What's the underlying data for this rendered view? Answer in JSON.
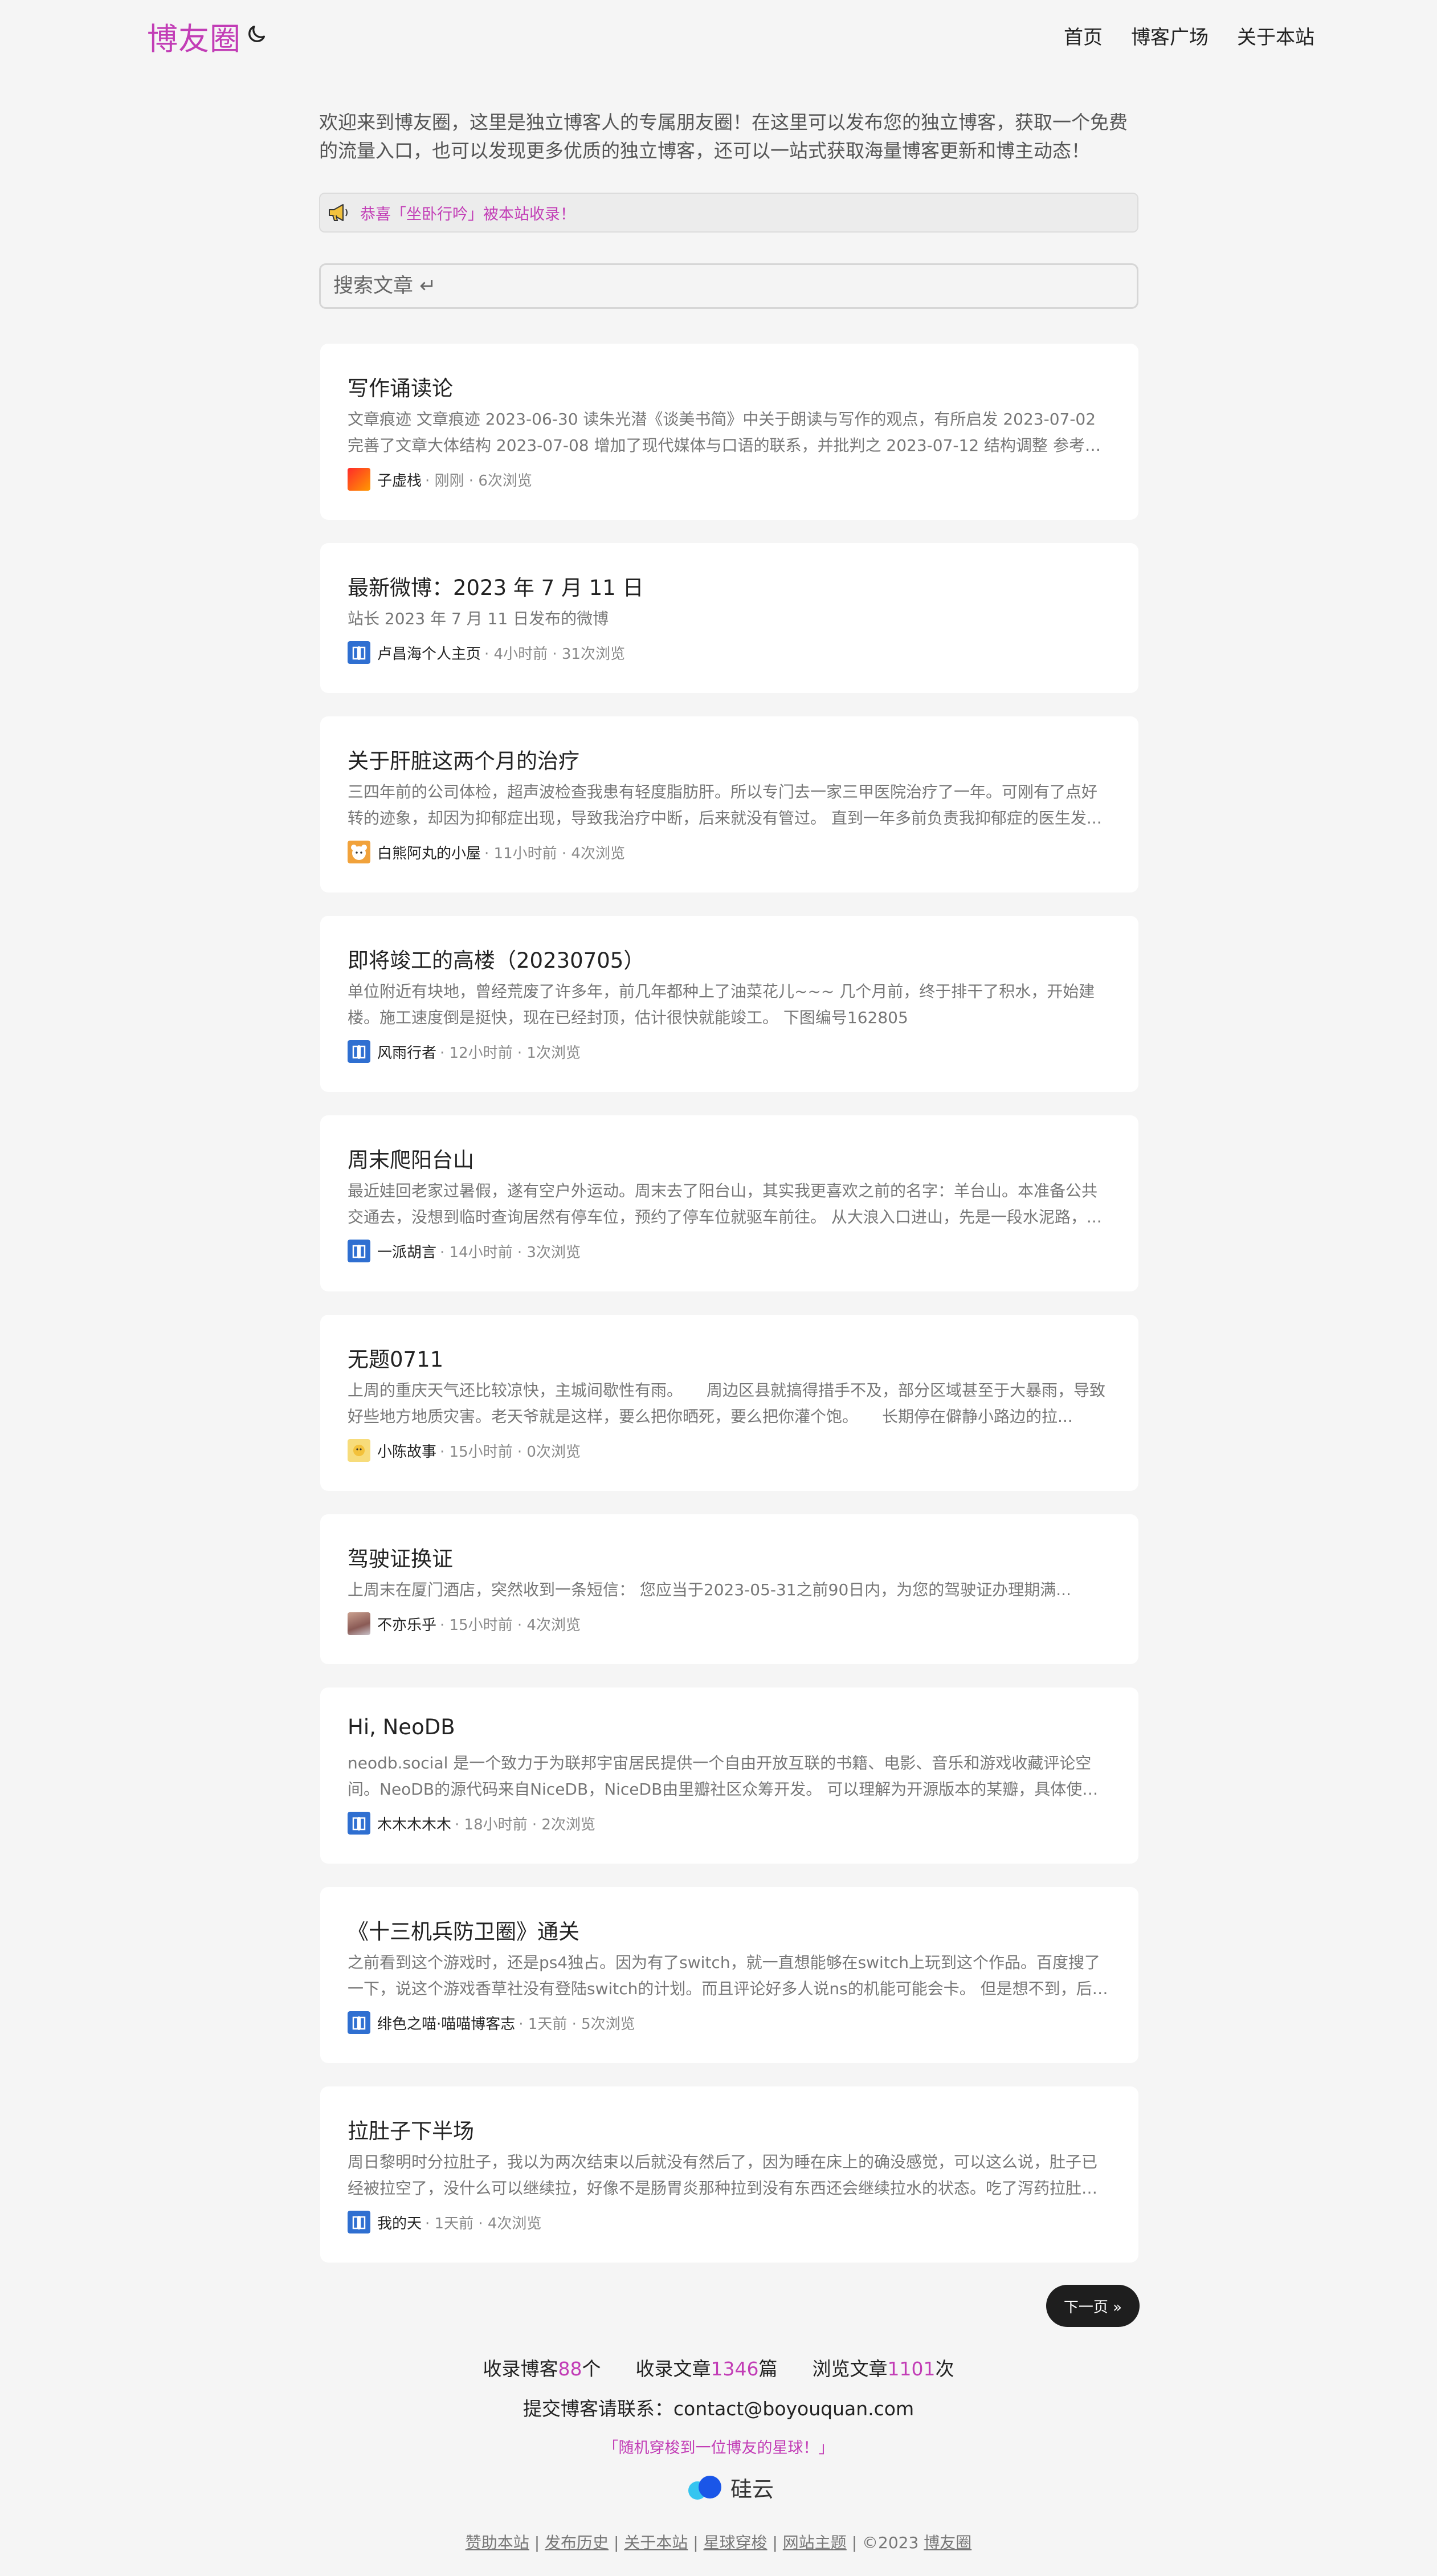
{
  "header": {
    "brand": "博友圈",
    "nav": [
      "首页",
      "博客广场",
      "关于本站"
    ]
  },
  "intro": "欢迎来到博友圈，这里是独立博客人的专属朋友圈！在这里可以发布您的独立博客，获取一个免费的流量入口，也可以发现更多优质的独立博客，还可以一站式获取海量博客更新和博主动态！",
  "notice": "恭喜「坐卧行吟」被本站收录！",
  "search": {
    "placeholder": "搜索文章 ↵"
  },
  "articles": [
    {
      "title": "写作诵读论",
      "excerpt": "文章痕迹 文章痕迹 2023-06-30 读朱光潜《谈美书简》中关于朗读与写作的观点，有所启发 2023-07-02 完善了文章大体结构 2023-07-08 增加了现代媒体与口语的联系，并批判之 2023-07-12 结构调整 参考了...",
      "author": "子虚栈",
      "meta": " · 刚刚 · 6次浏览",
      "avatar": "gradient-red"
    },
    {
      "title": "最新微博：2023 年 7 月 11 日",
      "excerpt": "站长 2023 年 7 月 11 日发布的微博",
      "author": "卢昌海个人主页",
      "meta": " · 4小时前 · 31次浏览",
      "avatar": "blue-book"
    },
    {
      "title": "关于肝脏这两个月的治疗",
      "excerpt": "三四年前的公司体检，超声波检查我患有轻度脂肪肝。所以专门去一家三甲医院治疗了一年。可刚有了点好转的迹象，却因为抑郁症出现，导致我治疗中断，后来就没有管过。 直到一年多前负责我抑郁症的医生发...",
      "author": "白熊阿丸的小屋",
      "meta": " · 11小时前 · 4次浏览",
      "avatar": "bear"
    },
    {
      "title": "即将竣工的高楼（20230705）",
      "excerpt": "单位附近有块地，曾经荒废了许多年，前几年都种上了油菜花儿~~~ 几个月前，终于排干了积水，开始建楼。施工速度倒是挺快，现在已经封顶，估计很快就能竣工。 下图编号162805",
      "author": "风雨行者",
      "meta": " · 12小时前 · 1次浏览",
      "avatar": "blue-book"
    },
    {
      "title": "周末爬阳台山",
      "excerpt": "最近娃回老家过暑假，遂有空户外运动。周末去了阳台山，其实我更喜欢之前的名字：羊台山。本准备公共交通去，没想到临时查询居然有停车位，预约了停车位就驱车前往。 从大浪入口进山，先是一段水泥路，...",
      "author": "一派胡言",
      "meta": " · 14小时前 · 3次浏览",
      "avatar": "blue-book"
    },
    {
      "title": "无题0711",
      "excerpt": "上周的重庆天气还比较凉快，主城间歇性有雨。　　周边区县就搞得措手不及，部分区域甚至于大暴雨，导致好些地方地质灾害。老天爷就是这样，要么把你晒死，要么把你灌个饱。　　长期停在僻静小路边的拉...",
      "author": "小陈故事",
      "meta": " · 15小时前 · 0次浏览",
      "avatar": "yellow"
    },
    {
      "title": "驾驶证换证",
      "excerpt": "上周末在厦门酒店，突然收到一条短信： 您应当于2023-05-31之前90日内，为您的驾驶证办理期满...",
      "author": "不亦乐乎",
      "meta": " · 15小时前 · 4次浏览",
      "avatar": "photo"
    },
    {
      "title": "Hi, NeoDB",
      "excerpt": "neodb.social 是一个致力于为联邦宇宙居民提供一个自由开放互联的书籍、电影、音乐和游戏收藏评论空间。NeoDB的源代码来自NiceDB，NiceDB由里瓣社区众筹开发。 可以理解为开源版本的某瓣，具体使用...",
      "author": "木木木木木",
      "meta": " · 18小时前 · 2次浏览",
      "avatar": "blue-book"
    },
    {
      "title": "《十三机兵防卫圈》通关",
      "excerpt": "之前看到这个游戏时，还是ps4独占。因为有了switch，就一直想能够在switch上玩到这个作品。百度搜了一下，说这个游戏香草社没有登陆switch的计划。而且评论好多人说ns的机能可能会卡。 但是想不到，后来...",
      "author": "绯色之喵·喵喵博客志",
      "meta": " · 1天前 · 5次浏览",
      "avatar": "blue-book"
    },
    {
      "title": "拉肚子下半场",
      "excerpt": "周日黎明时分拉肚子，我以为两次结束以后就没有然后了，因为睡在床上的确没感觉，可以这么说，肚子已经被拉空了，没什么可以继续拉，好像不是肠胃炎那种拉到没有东西还会继续拉水的状态。吃了泻药拉肚子...",
      "author": "我的天",
      "meta": " · 1天前 · 4次浏览",
      "avatar": "blue-book"
    }
  ],
  "pagination": {
    "next": "下一页 »"
  },
  "stats": {
    "blogs_label": "收录博客",
    "blogs_count": "88",
    "blogs_unit": "个",
    "articles_label": "收录文章",
    "articles_count": "1346",
    "articles_unit": "篇",
    "views_label": "浏览文章",
    "views_count": "1101",
    "views_unit": "次"
  },
  "contact": "提交博客请联系：contact@boyouquan.com",
  "random_link": "「随机穿梭到一位博友的星球！」",
  "sponsor": "硅云",
  "footer": {
    "links": [
      "赞助本站",
      "发布历史",
      "关于本站",
      "星球穿梭",
      "网站主题"
    ],
    "copyright": "©2023",
    "site": "博友圈"
  },
  "colors": {
    "accent": "#c23db6",
    "background": "#f5f5f5",
    "card": "#ffffff",
    "button": "#1e1e1e"
  }
}
